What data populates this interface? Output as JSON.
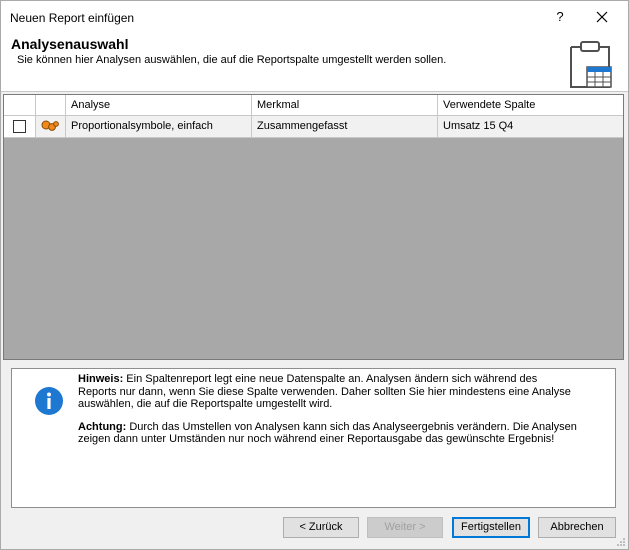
{
  "window": {
    "title": "Neuen Report einfügen",
    "help_label": "?"
  },
  "header": {
    "title": "Analysenauswahl",
    "subtitle": "Sie können hier Analysen auswählen, die auf die Reportspalte umgestellt werden sollen.",
    "icon": "clipboard-table-icon"
  },
  "grid": {
    "columns": [
      "Analyse",
      "Merkmal",
      "Verwendete Spalte"
    ],
    "rows": [
      {
        "checked": false,
        "icon": "proportional-symbols-icon",
        "analyse": "Proportionalsymbole, einfach",
        "merkmal": "Zusammengefasst",
        "spalte": "Umsatz 15 Q4"
      }
    ]
  },
  "info": {
    "icon": "info-icon",
    "hint_label": "Hinweis:",
    "hint_text": " Ein Spaltenreport legt eine neue Datenspalte an. Analysen ändern sich während des Reports nur dann, wenn Sie diese Spalte verwenden. Daher sollten Sie hier mindestens eine Analyse auswählen, die auf die Reportspalte umgestellt wird.",
    "warning_label": "Achtung:",
    "warning_text": " Durch das Umstellen von Analysen kann sich das Analyseergebnis verändern. Die Analysen zeigen dann unter Umständen nur noch während einer Reportausgabe das gewünschte Ergebnis!"
  },
  "buttons": {
    "back": "< Zurück",
    "next": "Weiter >",
    "finish": "Fertigstellen",
    "cancel": "Abbrechen"
  },
  "colors": {
    "accent": "#0078d7",
    "info_blue": "#1e78d2",
    "symbol_orange": "#f08a1c"
  }
}
